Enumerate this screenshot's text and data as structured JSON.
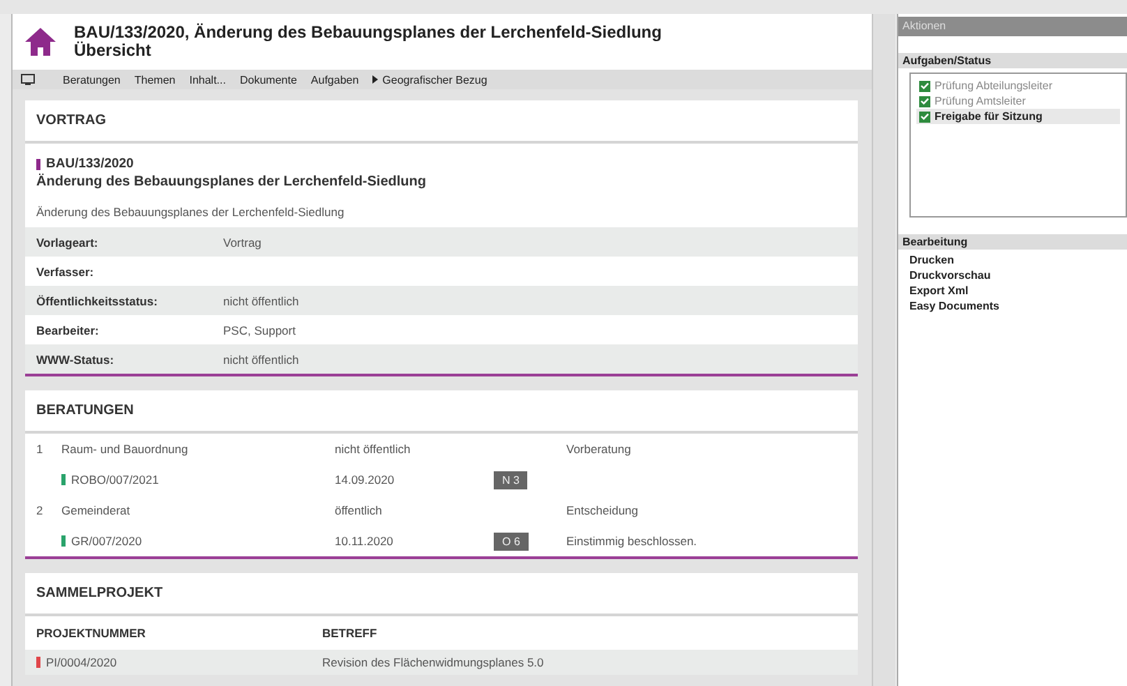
{
  "header": {
    "title": "BAU/133/2020, Änderung des Bebauungsplanes der Lerchenfeld-Siedlung",
    "subtitle": "Übersicht"
  },
  "toolbar": [
    {
      "label": "Beratungen",
      "kind": "tab"
    },
    {
      "label": "Themen",
      "kind": "tab"
    },
    {
      "label": "Inhalt...",
      "kind": "tab"
    },
    {
      "label": "Dokumente",
      "kind": "tab"
    },
    {
      "label": "Aufgaben",
      "kind": "tab"
    },
    {
      "label": "Geografischer Bezug",
      "kind": "expander"
    }
  ],
  "vortrag": {
    "heading": "VORTRAG",
    "code": "BAU/133/2020",
    "color": "#8e2a8b",
    "title": "Änderung des Bebauungsplanes der Lerchenfeld-Siedlung",
    "description": "Änderung des Bebauungsplanes der Lerchenfeld-Siedlung",
    "fields": [
      {
        "label": "Vorlageart:",
        "value": "Vortrag"
      },
      {
        "label": "Verfasser:"
      },
      {
        "label": "Öffentlichkeitsstatus:",
        "value": "nicht öffentlich"
      },
      {
        "label": "Bearbeiter:",
        "value": "PSC, Support"
      },
      {
        "label": "WWW-Status:",
        "value": "nicht öffentlich"
      }
    ]
  },
  "beratungen": {
    "heading": "BERATUNGEN",
    "rows": [
      {
        "number": "1",
        "body": "Raum- und Bauordnung",
        "status": "nicht öffentlich",
        "type": "Vorberatung",
        "code": "ROBO/007/2021",
        "color": "#2aa36b",
        "date": "14.09.2020",
        "badge": "N 3"
      },
      {
        "number": "2",
        "body": "Gemeinderat",
        "status": "öffentlich",
        "type": "Entscheidung",
        "code": "GR/007/2020",
        "color": "#2aa36b",
        "date": "10.11.2020",
        "badge": "O 6",
        "result": "Einstimmig beschlossen."
      }
    ]
  },
  "sammelprojekt": {
    "heading": "SAMMELPROJEKT",
    "columns": [
      "PROJEKTNUMMER",
      "BETREFF"
    ],
    "rows": [
      {
        "number": "PI/0004/2020",
        "color": "#e0464a",
        "subject": "Revision des Flächenwidmungsplanes 5.0"
      }
    ]
  },
  "sidebar": {
    "title": "Aktionen",
    "tasks_heading": "Aufgaben/Status",
    "tasks": [
      {
        "label": "Prüfung Abteilungsleiter",
        "checked": true,
        "disabled": true,
        "selected": false
      },
      {
        "label": "Prüfung Amtsleiter",
        "checked": true,
        "disabled": true,
        "selected": false
      },
      {
        "label": "Freigabe für Sitzung",
        "checked": true,
        "disabled": false,
        "selected": true
      }
    ],
    "edit_heading": "Bearbeitung",
    "actions": [
      "Drucken",
      "Druckvorschau",
      "Export Xml",
      "Easy Documents"
    ]
  }
}
